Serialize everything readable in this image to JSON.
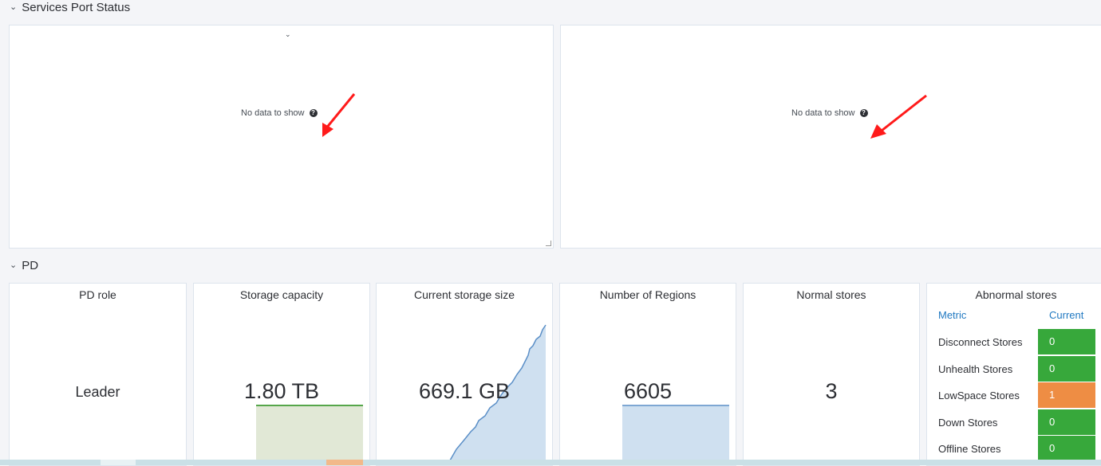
{
  "rows": {
    "services": {
      "title": "Services Port Status",
      "chevron": "chevron-down-icon"
    },
    "pd": {
      "title": "PD",
      "chevron": "chevron-down-icon"
    }
  },
  "services_panels": [
    {
      "no_data": "No data to show",
      "help": "?"
    },
    {
      "no_data": "No data to show",
      "help": "?"
    }
  ],
  "pd_panels": {
    "pd_role": {
      "title": "PD role",
      "value": "Leader"
    },
    "storage_capacity": {
      "title": "Storage capacity",
      "value": "1.80 TB"
    },
    "current_storage": {
      "title": "Current storage size",
      "value": "669.1 GB"
    },
    "regions": {
      "title": "Number of Regions",
      "value": "6605"
    },
    "normal_stores": {
      "title": "Normal stores",
      "value": "3"
    },
    "abnormal_stores": {
      "title": "Abnormal stores",
      "columns": [
        "Metric",
        "Current"
      ],
      "rows": [
        {
          "metric": "Disconnect Stores",
          "current": "0",
          "color": "#37a83b"
        },
        {
          "metric": "Unhealth Stores",
          "current": "0",
          "color": "#37a83b"
        },
        {
          "metric": "LowSpace Stores",
          "current": "1",
          "color": "#ee8d44"
        },
        {
          "metric": "Down Stores",
          "current": "0",
          "color": "#37a83b"
        },
        {
          "metric": "Offline Stores",
          "current": "0",
          "color": "#37a83b"
        }
      ]
    }
  },
  "colors": {
    "arrow": "#ff1a1a",
    "capacity_fill": "#e1e8d6",
    "capacity_line": "#56a64b",
    "area_fill": "#cfe0f0",
    "area_line": "#5b8fc7",
    "link_blue": "#1f78c1"
  }
}
